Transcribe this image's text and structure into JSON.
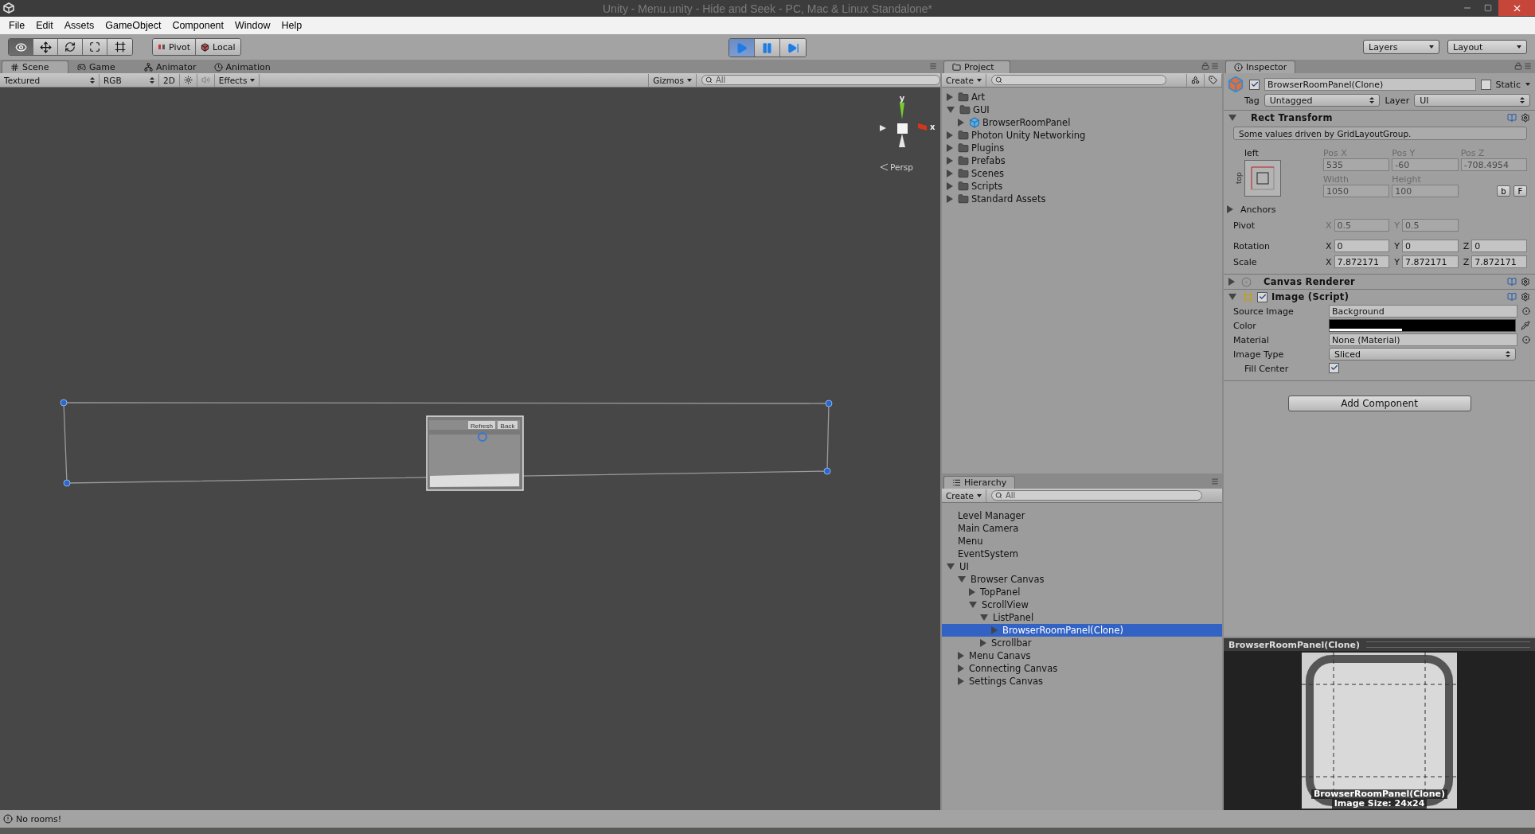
{
  "window": {
    "title": "Unity - Menu.unity - Hide and Seek - PC, Mac & Linux Standalone*"
  },
  "menu": [
    "File",
    "Edit",
    "Assets",
    "GameObject",
    "Component",
    "Window",
    "Help"
  ],
  "toolbar": {
    "tools": [
      {
        "kind": "view",
        "selected": true
      },
      {
        "kind": "move",
        "selected": false
      },
      {
        "kind": "rotate",
        "selected": false
      },
      {
        "kind": "scale",
        "selected": false
      },
      {
        "kind": "rect",
        "selected": false
      }
    ],
    "pivot": "Pivot",
    "local": "Local",
    "playback": [
      {
        "kind": "play",
        "selected": true
      },
      {
        "kind": "pause",
        "selected": false
      },
      {
        "kind": "step",
        "selected": false
      }
    ],
    "layers": "Layers",
    "layout": "Layout"
  },
  "scene": {
    "tabs": [
      {
        "kind": "scene",
        "label": "Scene",
        "selected": true
      },
      {
        "kind": "game",
        "label": "Game",
        "selected": false
      },
      {
        "kind": "animator",
        "label": "Animator",
        "selected": false
      },
      {
        "kind": "animation",
        "label": "Animation",
        "selected": false
      }
    ],
    "shading": "Textured",
    "render_mode": "RGB",
    "mode_2d": "2D",
    "effects": "Effects",
    "gizmos": "Gizmos",
    "search_placeholder": "All",
    "canvas_buttons": [
      "Refresh",
      "Back"
    ],
    "gizmo": {
      "y_label": "y",
      "x_label": "x",
      "projection": "Persp"
    }
  },
  "project": {
    "tab": "Project",
    "create": "Create",
    "items": [
      {
        "kind": "folder",
        "label": "Art",
        "expanded": false
      },
      {
        "kind": "folder",
        "label": "GUI",
        "expanded": true,
        "children": [
          {
            "kind": "prefab",
            "label": "BrowserRoomPanel",
            "expanded": false
          }
        ]
      },
      {
        "kind": "folder",
        "label": "Photon Unity Networking",
        "expanded": false
      },
      {
        "kind": "folder",
        "label": "Plugins",
        "expanded": false
      },
      {
        "kind": "folder",
        "label": "Prefabs",
        "expanded": false
      },
      {
        "kind": "folder",
        "label": "Scenes",
        "expanded": false
      },
      {
        "kind": "folder",
        "label": "Scripts",
        "expanded": false
      },
      {
        "kind": "folder",
        "label": "Standard Assets",
        "expanded": false
      }
    ]
  },
  "hierarchy": {
    "tab": "Hierarchy",
    "create": "Create",
    "search_placeholder": "All",
    "items": [
      {
        "label": "Level Manager",
        "selected": false
      },
      {
        "label": "Main Camera",
        "selected": false
      },
      {
        "label": "Menu",
        "selected": false
      },
      {
        "label": "EventSystem",
        "selected": false
      },
      {
        "label": "UI",
        "selected": false,
        "expanded": true,
        "children": [
          {
            "label": "Browser Canvas",
            "selected": false,
            "expanded": true,
            "children": [
              {
                "label": "TopPanel",
                "selected": false,
                "expanded": false
              },
              {
                "label": "ScrollView",
                "selected": false,
                "expanded": true,
                "children": [
                  {
                    "label": "ListPanel",
                    "selected": false,
                    "expanded": true,
                    "children": [
                      {
                        "label": "BrowserRoomPanel(Clone)",
                        "selected": true,
                        "expanded": false
                      }
                    ]
                  },
                  {
                    "label": "Scrollbar",
                    "selected": false,
                    "expanded": false
                  }
                ]
              }
            ]
          },
          {
            "label": "Menu Canavs",
            "selected": false,
            "expanded": false
          },
          {
            "label": "Connecting Canvas",
            "selected": false,
            "expanded": false
          },
          {
            "label": "Settings Canvas",
            "selected": false,
            "expanded": false
          }
        ]
      }
    ]
  },
  "inspector": {
    "tab": "Inspector",
    "active": true,
    "name": "BrowserRoomPanel(Clone)",
    "static": {
      "label": "Static",
      "checked": false
    },
    "tag": {
      "label": "Tag",
      "value": "Untagged"
    },
    "layer": {
      "label": "Layer",
      "value": "UI"
    },
    "rect_transform": {
      "title": "Rect Transform",
      "expanded": true,
      "note": "Some values driven by GridLayoutGroup.",
      "anchor_h": "left",
      "anchor_v": "top",
      "fields": [
        {
          "label": "Pos X",
          "value": "535",
          "disabled": true
        },
        {
          "label": "Pos Y",
          "value": "-60",
          "disabled": true
        },
        {
          "label": "Pos Z",
          "value": "-708.4954",
          "disabled": true
        },
        {
          "label": "Width",
          "value": "1050",
          "disabled": true
        },
        {
          "label": "Height",
          "value": "100",
          "disabled": true
        }
      ],
      "buttons": [
        "b",
        "F"
      ],
      "anchors": {
        "label": "Anchors",
        "expanded": false
      },
      "vectors": [
        {
          "label": "Pivot",
          "disabled": true,
          "parts": [
            {
              "axis": "X",
              "value": "0.5"
            },
            {
              "axis": "Y",
              "value": "0.5"
            }
          ]
        },
        {
          "label": "Rotation",
          "disabled": false,
          "parts": [
            {
              "axis": "X",
              "value": "0"
            },
            {
              "axis": "Y",
              "value": "0"
            },
            {
              "axis": "Z",
              "value": "0"
            }
          ]
        },
        {
          "label": "Scale",
          "disabled": false,
          "parts": [
            {
              "axis": "X",
              "value": "7.872171"
            },
            {
              "axis": "Y",
              "value": "7.872171"
            },
            {
              "axis": "Z",
              "value": "7.872171"
            }
          ]
        }
      ]
    },
    "canvas_renderer": {
      "title": "Canvas Renderer",
      "expanded": false
    },
    "image": {
      "title": "Image (Script)",
      "expanded": true,
      "enabled": true,
      "props": [
        {
          "kind": "object",
          "label": "Source Image",
          "value": "Background"
        },
        {
          "kind": "color",
          "label": "Color",
          "color": "#000000",
          "level": 0.39
        },
        {
          "kind": "object",
          "label": "Material",
          "value": "None (Material)"
        },
        {
          "kind": "dropdown",
          "label": "Image Type",
          "value": "Sliced"
        },
        {
          "kind": "checkbox",
          "label": "Fill Center",
          "checked": true
        }
      ]
    },
    "add_component": "Add Component"
  },
  "preview": {
    "title": "BrowserRoomPanel(Clone)",
    "caption": [
      "BrowserRoomPanel(Clone)",
      "Image Size: 24x24"
    ]
  },
  "status": "No rooms!"
}
